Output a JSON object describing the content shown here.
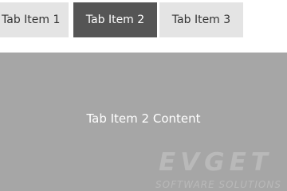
{
  "tabs": [
    {
      "label": "Tab Item 1",
      "selected": false
    },
    {
      "label": "Tab Item 2",
      "selected": true
    },
    {
      "label": "Tab Item 3",
      "selected": false
    }
  ],
  "content": {
    "text": "Tab Item 2 Content"
  },
  "watermark": {
    "brand": "EVGET",
    "tagline": "SOFTWARE SOLUTIONS"
  },
  "colors": {
    "tab_bg": "#e4e4e4",
    "tab_selected_bg": "#555555",
    "content_bg": "#a6a6a6"
  }
}
